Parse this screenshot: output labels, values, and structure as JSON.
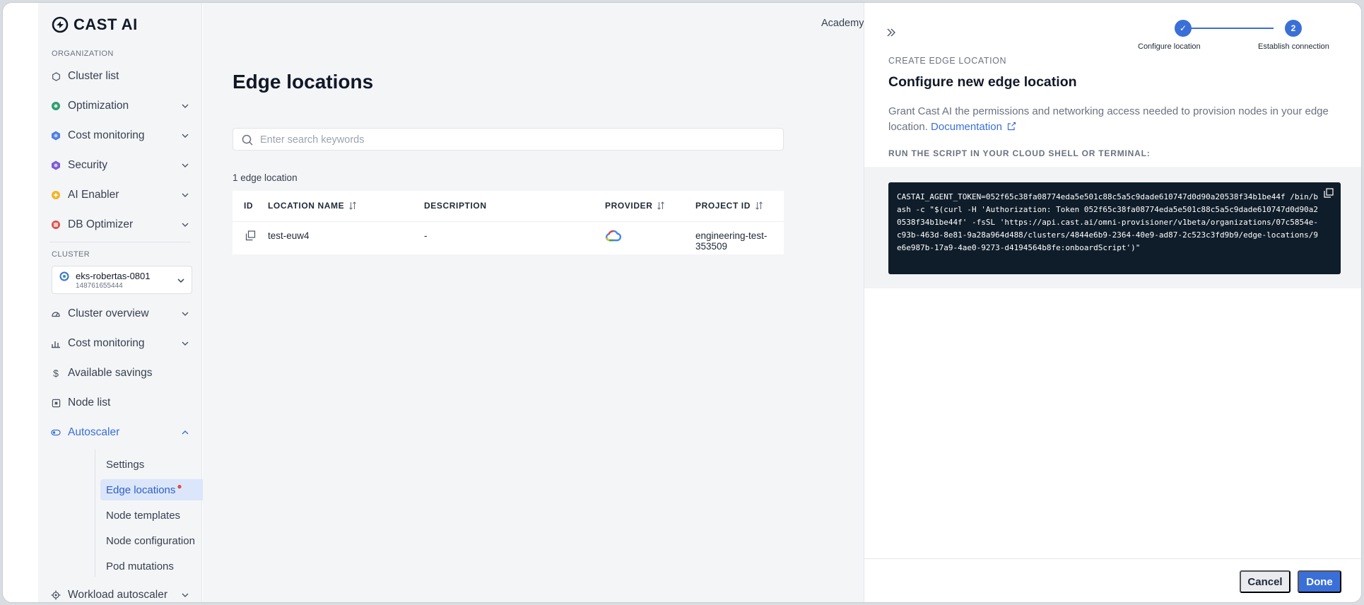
{
  "brand": {
    "name": "CAST AI"
  },
  "sidebar": {
    "org_label": "ORGANIZATION",
    "org_items": [
      {
        "label": "Cluster list",
        "icon": "hexagon-icon"
      },
      {
        "label": "Optimization",
        "icon": "optimization-icon"
      },
      {
        "label": "Cost monitoring",
        "icon": "cost-monitoring-icon"
      },
      {
        "label": "Security",
        "icon": "security-icon"
      },
      {
        "label": "AI Enabler",
        "icon": "ai-enabler-icon"
      },
      {
        "label": "DB Optimizer",
        "icon": "db-optimizer-icon"
      }
    ],
    "cluster_label": "CLUSTER",
    "cluster": {
      "name": "eks-robertas-0801",
      "id": "148761655444"
    },
    "cluster_items": [
      {
        "label": "Cluster overview",
        "icon": "gauge-icon"
      },
      {
        "label": "Cost monitoring",
        "icon": "bar-chart-icon"
      },
      {
        "label": "Available savings",
        "icon": "dollar-icon"
      },
      {
        "label": "Node list",
        "icon": "node-icon"
      },
      {
        "label": "Autoscaler",
        "icon": "autoscaler-icon"
      }
    ],
    "autoscaler_sub": [
      {
        "label": "Settings"
      },
      {
        "label": "Edge locations"
      },
      {
        "label": "Node templates"
      },
      {
        "label": "Node configuration"
      },
      {
        "label": "Pod mutations"
      }
    ],
    "workload_autoscaler": "Workload autoscaler"
  },
  "header": {
    "academy": "Academy"
  },
  "main": {
    "title": "Edge locations",
    "search_placeholder": "Enter search keywords",
    "count": "1 edge location",
    "columns": {
      "id": "ID",
      "name": "LOCATION NAME",
      "description": "DESCRIPTION",
      "provider": "PROVIDER",
      "project": "PROJECT ID"
    },
    "rows": [
      {
        "name": "test-euw4",
        "description": "-",
        "provider": "gcp",
        "project": "engineering-test-353509"
      }
    ]
  },
  "drawer": {
    "steps": [
      {
        "label": "Configure location",
        "marker": "✓"
      },
      {
        "label": "Establish connection",
        "marker": "2"
      }
    ],
    "overline": "CREATE EDGE LOCATION",
    "title": "Configure new edge location",
    "description": "Grant Cast AI the permissions and networking access needed to provision nodes in your edge location.",
    "doc_link": "Documentation",
    "run_label": "RUN THE SCRIPT IN YOUR CLOUD SHELL OR TERMINAL:",
    "script": "CASTAI_AGENT_TOKEN=052f65c38fa08774eda5e501c88c5a5c9dade610747d0d90a20538f34b1be44f /bin/bash -c \"$(curl -H 'Authorization: Token 052f65c38fa08774eda5e501c88c5a5c9dade610747d0d90a20538f34b1be44f' -fsSL 'https://api.cast.ai/omni-provisioner/v1beta/organizations/07c5854e-c93b-463d-8e81-9a28a964d488/clusters/4844e6b9-2364-40e9-ad87-2c523c3fd9b9/edge-locations/9e6e987b-17a9-4ae0-9273-d4194564b8fe:onboardScript')\"",
    "cancel": "Cancel",
    "done": "Done"
  },
  "colors": {
    "accent": "#3b6fd8",
    "code_bg": "#0f1d2a",
    "badge_red": "#e04a4a"
  }
}
